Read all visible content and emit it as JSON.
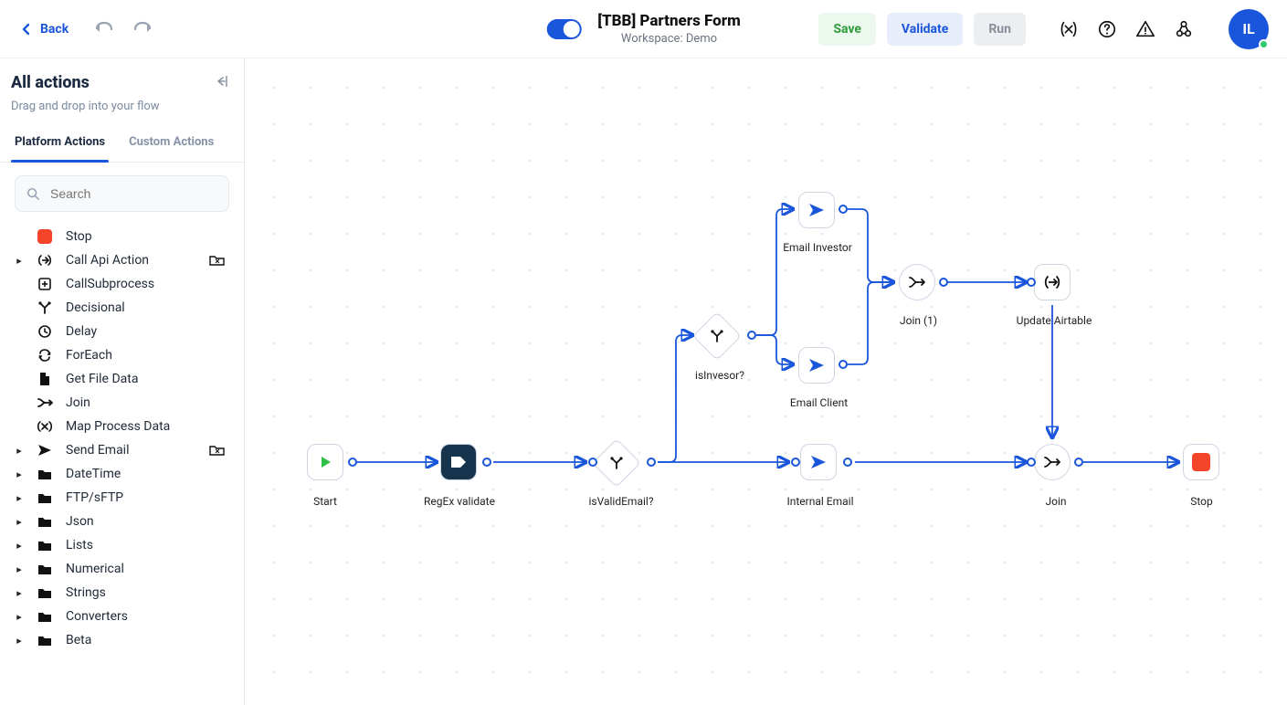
{
  "topbar": {
    "back": "Back",
    "title": "[TBB] Partners Form",
    "subtitle": "Workspace: Demo",
    "save": "Save",
    "validate": "Validate",
    "run": "Run",
    "avatar_initials": "IL"
  },
  "sidebar": {
    "title": "All actions",
    "subtitle": "Drag and drop into your flow",
    "tab_platform": "Platform Actions",
    "tab_custom": "Custom Actions",
    "search_placeholder": "Search",
    "items": {
      "stop": "Stop",
      "call_api": "Call Api Action",
      "call_sub": "CallSubprocess",
      "decisional": "Decisional",
      "delay": "Delay",
      "foreach": "ForEach",
      "get_file": "Get File Data",
      "join": "Join",
      "map_proc": "Map Process Data",
      "send_email": "Send Email",
      "datetime": "DateTime",
      "ftp": "FTP/sFTP",
      "json": "Json",
      "lists": "Lists",
      "numerical": "Numerical",
      "strings": "Strings",
      "converters": "Converters",
      "beta": "Beta"
    }
  },
  "nodes": {
    "start": "Start",
    "regex": "RegEx validate",
    "isvalid": "isValidEmail?",
    "isinvestor": "isInvesor?",
    "email_investor": "Email Investor",
    "email_client": "Email Client",
    "internal_email": "Internal Email",
    "join1": "Join (1)",
    "update_airtable": "Update Airtable",
    "join": "Join",
    "stop": "Stop"
  }
}
